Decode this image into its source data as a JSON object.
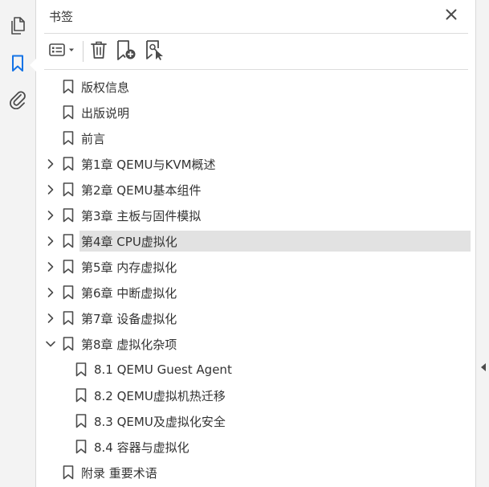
{
  "panel": {
    "title": "书签"
  },
  "rail": {
    "items": [
      {
        "name": "pages-icon"
      },
      {
        "name": "bookmark-icon",
        "active": true
      },
      {
        "name": "attachment-icon"
      }
    ]
  },
  "toolbar": {
    "buttons": [
      "options-menu-icon",
      "delete-icon",
      "new-bookmark-icon",
      "find-bookmark-icon"
    ]
  },
  "colors": {
    "accent": "#1473e6",
    "selected_bg": "#e2e2e2",
    "text": "#333333"
  },
  "bookmarks": [
    {
      "label": "版权信息",
      "level": 0,
      "expander": "none"
    },
    {
      "label": "出版说明",
      "level": 0,
      "expander": "none"
    },
    {
      "label": "前言",
      "level": 0,
      "expander": "none"
    },
    {
      "label": "第1章 QEMU与KVM概述",
      "level": 0,
      "expander": "collapsed"
    },
    {
      "label": "第2章 QEMU基本组件",
      "level": 0,
      "expander": "collapsed"
    },
    {
      "label": "第3章 主板与固件模拟",
      "level": 0,
      "expander": "collapsed"
    },
    {
      "label": "第4章 CPU虚拟化",
      "level": 0,
      "expander": "collapsed",
      "selected": true
    },
    {
      "label": "第5章 内存虚拟化",
      "level": 0,
      "expander": "collapsed"
    },
    {
      "label": "第6章 中断虚拟化",
      "level": 0,
      "expander": "collapsed"
    },
    {
      "label": "第7章 设备虚拟化",
      "level": 0,
      "expander": "collapsed"
    },
    {
      "label": "第8章 虚拟化杂项",
      "level": 0,
      "expander": "expanded"
    },
    {
      "label": "8.1 QEMU Guest Agent",
      "level": 1,
      "expander": "none"
    },
    {
      "label": "8.2 QEMU虚拟机热迁移",
      "level": 1,
      "expander": "none"
    },
    {
      "label": "8.3 QEMU及虚拟化安全",
      "level": 1,
      "expander": "none"
    },
    {
      "label": "8.4 容器与虚拟化",
      "level": 1,
      "expander": "none"
    },
    {
      "label": "附录 重要术语",
      "level": 0,
      "expander": "none"
    }
  ]
}
